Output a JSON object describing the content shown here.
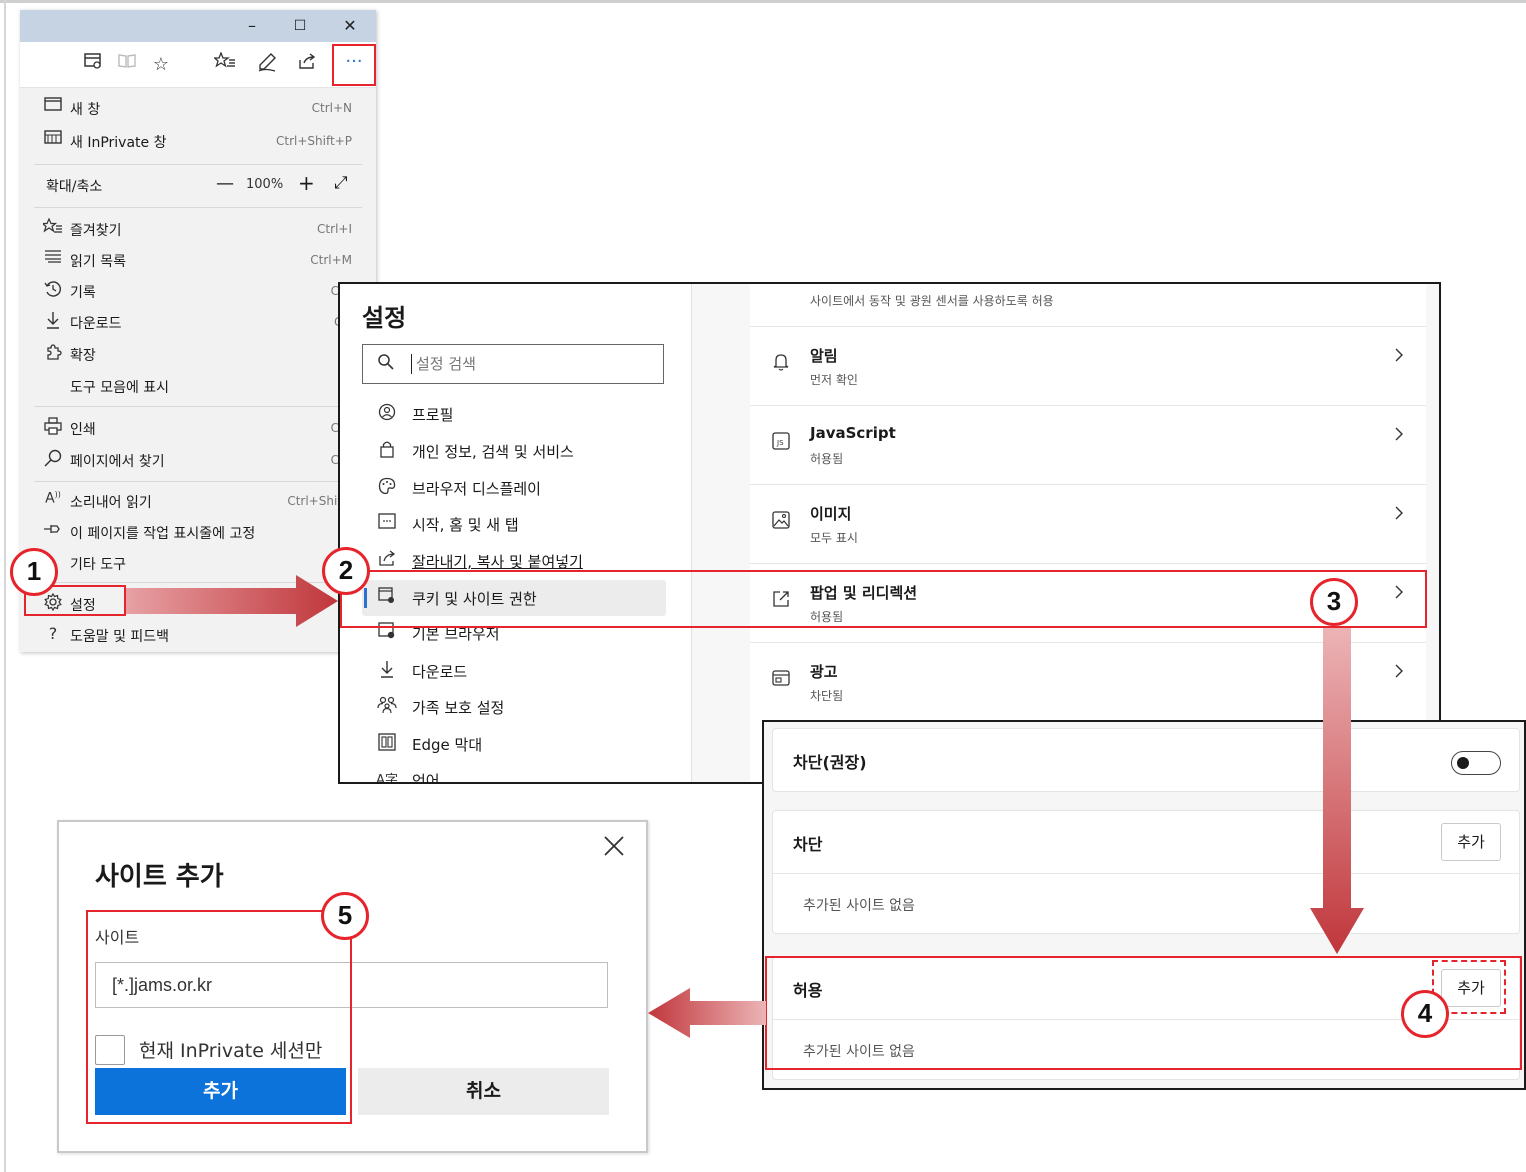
{
  "menu": {
    "window_controls": {
      "minimize": "–",
      "maximize": "☐",
      "close": "✕"
    },
    "more_button": "···",
    "items": {
      "new_window": {
        "label": "새 창",
        "shortcut": "Ctrl+N"
      },
      "new_inprivate": {
        "label": "새 InPrivate 창",
        "shortcut": "Ctrl+Shift+P"
      },
      "zoom": {
        "label": "확대/축소",
        "value": "100%",
        "minus": "—",
        "plus": "+",
        "expand": "⤢"
      },
      "favorites": {
        "label": "즐겨찾기",
        "shortcut": "Ctrl+I"
      },
      "reading_list": {
        "label": "읽기 목록",
        "shortcut": "Ctrl+M"
      },
      "history": {
        "label": "기록",
        "shortcut": "Ctrl"
      },
      "downloads": {
        "label": "다운로드",
        "shortcut": "Ctr"
      },
      "extensions": {
        "label": "확장"
      },
      "show_in_toolbar": {
        "label": "도구 모음에 표시"
      },
      "print": {
        "label": "인쇄",
        "shortcut": "Ctrl"
      },
      "find_on_page": {
        "label": "페이지에서 찾기",
        "shortcut": "Ctrl"
      },
      "read_aloud": {
        "label": "소리내어 읽기",
        "shortcut": "Ctrl+Shift"
      },
      "pin_taskbar": {
        "label": "이 페이지를 작업 표시줄에 고정"
      },
      "more_tools": {
        "label": "기타 도구"
      },
      "settings": {
        "label": "설정"
      },
      "help": {
        "label": "도움말 및 피드백"
      }
    }
  },
  "settings": {
    "title": "설정",
    "search_placeholder": "설정 검색",
    "nav": {
      "profile": "프로필",
      "privacy": "개인 정보, 검색 및 서비스",
      "appearance": "브라우저 디스플레이",
      "start_home": "시작, 홈 및 새 탭",
      "clipboard": "잘라내기, 복사 및 붙여넣기",
      "cookies": "쿠키 및 사이트 권한",
      "default_browser": "기본 브라우저",
      "downloads": "다운로드",
      "family": "가족 보호 설정",
      "edge_bar": "Edge 막대",
      "languages": "언어"
    },
    "top_note": "사이트에서 동작 및 광원 센서를 사용하도록 허용",
    "rows": {
      "notifications": {
        "title": "알림",
        "status": "먼저 확인"
      },
      "javascript": {
        "title": "JavaScript",
        "status": "허용됨"
      },
      "images": {
        "title": "이미지",
        "status": "모두 표시"
      },
      "popups": {
        "title": "팝업 및 리디렉션",
        "status": "허용됨"
      },
      "ads": {
        "title": "광고",
        "status": "차단됨"
      }
    }
  },
  "popups": {
    "block_recommended": "차단(권장)",
    "block": {
      "title": "차단",
      "add": "추가",
      "empty": "추가된 사이트 없음"
    },
    "allow": {
      "title": "허용",
      "add": "추가",
      "empty": "추가된 사이트 없음"
    }
  },
  "dialog": {
    "title": "사이트 추가",
    "site_label": "사이트",
    "site_value": "[*.]jams.or.kr",
    "checkbox_label": "현재 InPrivate 세션만",
    "add": "추가",
    "cancel": "취소"
  },
  "steps": [
    "1",
    "2",
    "3",
    "4",
    "5"
  ],
  "colors": {
    "highlight": "#e6242c",
    "primary_button": "#0b73d9",
    "arrow": "#c0363b"
  },
  "icons": {
    "menu": [
      "new-window-icon",
      "inprivate-icon",
      "favorites-icon",
      "reading-list-icon",
      "history-icon",
      "download-icon",
      "extensions-icon",
      "print-icon",
      "find-icon",
      "read-aloud-icon",
      "pin-icon",
      "gear-icon",
      "help-icon"
    ],
    "settings": [
      "search-icon",
      "profile-icon",
      "lock-icon",
      "palette-icon",
      "home-tab-icon",
      "share-icon",
      "cookie-icon",
      "browser-icon",
      "download-icon",
      "family-icon",
      "edge-bar-icon",
      "language-icon",
      "bell-icon",
      "javascript-icon",
      "image-icon",
      "popup-icon",
      "ads-icon",
      "chevron-right-icon"
    ]
  }
}
